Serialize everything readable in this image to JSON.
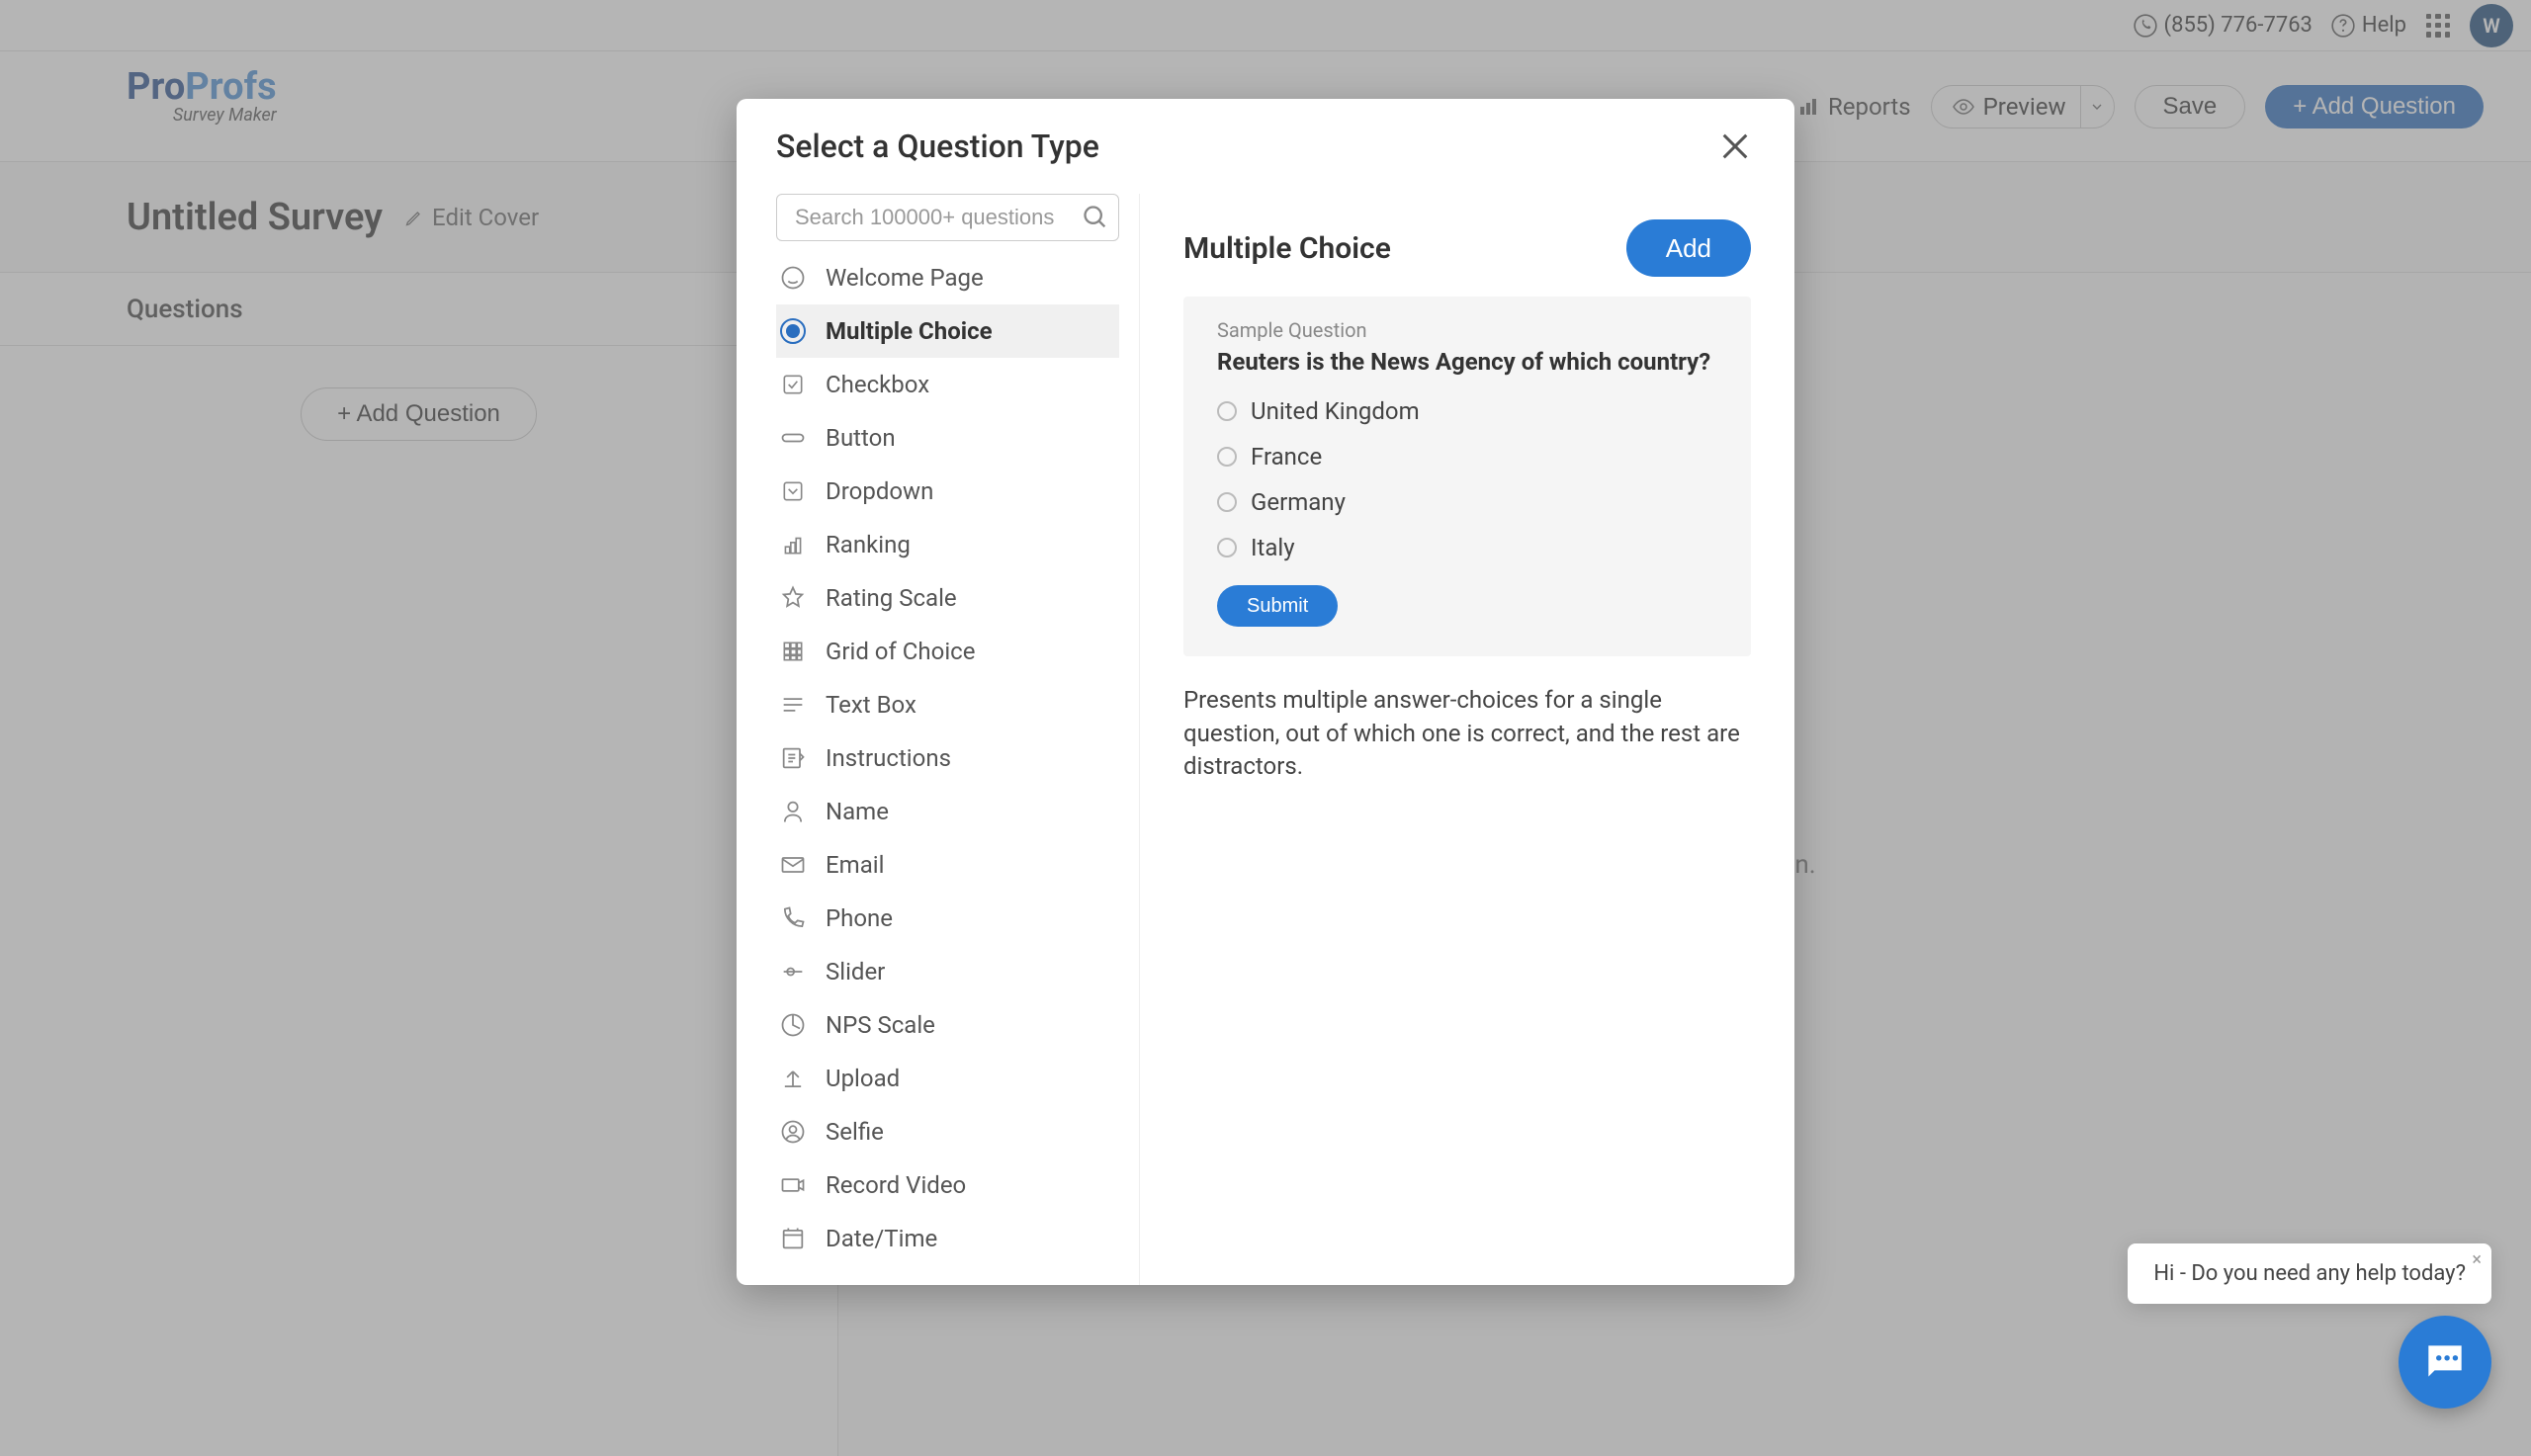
{
  "topbar": {
    "phone": "(855) 776-7763",
    "help": "Help",
    "avatar_initial": "W"
  },
  "brand": {
    "line1a": "Pro",
    "line1b": "Profs",
    "sub": "Survey Maker"
  },
  "header": {
    "reports": "Reports",
    "preview": "Preview",
    "save": "Save",
    "add_question": "+ Add Question"
  },
  "title_row": {
    "survey_title": "Untitled Survey",
    "edit_cover": "Edit Cover"
  },
  "left_panel": {
    "tab": "Questions",
    "add_question": "+ Add Question"
  },
  "right_panel": {
    "placeholder_suffix": "add your first question."
  },
  "modal": {
    "title": "Select a Question Type",
    "search_placeholder": "Search 100000+ questions",
    "types": [
      "Welcome Page",
      "Multiple Choice",
      "Checkbox",
      "Button",
      "Dropdown",
      "Ranking",
      "Rating Scale",
      "Grid of Choice",
      "Text Box",
      "Instructions",
      "Name",
      "Email",
      "Phone",
      "Slider",
      "NPS Scale",
      "Upload",
      "Selfie",
      "Record Video",
      "Date/Time"
    ],
    "selected_index": 1,
    "preview": {
      "type_name": "Multiple Choice",
      "add": "Add",
      "sample_label": "Sample Question",
      "sample_question": "Reuters is the News Agency of which country?",
      "options": [
        "United Kingdom",
        "France",
        "Germany",
        "Italy"
      ],
      "submit": "Submit",
      "description": "Presents multiple answer-choices for a single question, out of which one is correct, and the rest are distractors."
    }
  },
  "chat": {
    "tip": "Hi - Do you need any help today?"
  }
}
